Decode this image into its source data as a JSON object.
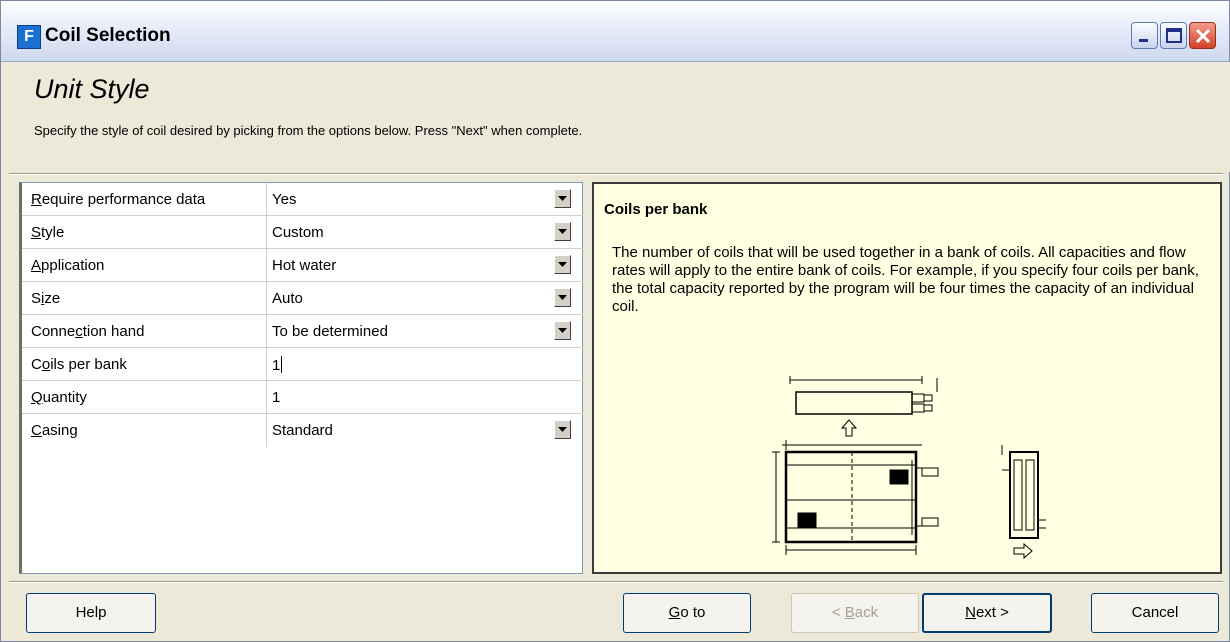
{
  "window": {
    "title": "Coil Selection",
    "app_icon_glyph": "F"
  },
  "header": {
    "title": "Unit Style",
    "description": "Specify the style of coil desired by picking from the options below.  Press \"Next\" when complete."
  },
  "properties": [
    {
      "pre": "",
      "accel": "R",
      "post": "equire performance data",
      "value": "Yes",
      "dropdown": true
    },
    {
      "pre": "",
      "accel": "S",
      "post": "tyle",
      "value": "Custom",
      "dropdown": true
    },
    {
      "pre": "",
      "accel": "A",
      "post": "pplication",
      "value": "Hot water",
      "dropdown": true
    },
    {
      "pre": "S",
      "accel": "i",
      "post": "ze",
      "value": "Auto",
      "dropdown": true
    },
    {
      "pre": "Conne",
      "accel": "c",
      "post": "tion hand",
      "value": "To be determined",
      "dropdown": true
    },
    {
      "pre": "C",
      "accel": "o",
      "post": "ils per bank",
      "value": "1",
      "dropdown": false,
      "editing": true
    },
    {
      "pre": "",
      "accel": "Q",
      "post": "uantity",
      "value": "1",
      "dropdown": false
    },
    {
      "pre": "",
      "accel": "C",
      "post": "asing",
      "value": "Standard",
      "dropdown": true
    }
  ],
  "help": {
    "title": "Coils per bank",
    "text": "The number of coils that will be used together in a bank of coils.  All capacities and flow rates will apply to the entire bank of coils.  For example, if you specify four coils per bank, the total capacity reported by the program will be four times the capacity of an individual coil."
  },
  "buttons": {
    "help": "Help",
    "goto_accel": "G",
    "goto_rest": "o to",
    "back_pre": "< ",
    "back_accel": "B",
    "back_rest": "ack",
    "next_accel": "N",
    "next_rest": "ext >",
    "cancel": "Cancel"
  },
  "colors": {
    "help_background": "#ffffe1",
    "dialog_background": "#ece9d8",
    "close_button": "#d4412a"
  },
  "icons": [
    "app-icon",
    "minimize-icon",
    "maximize-icon",
    "close-icon",
    "dropdown-arrow-icon",
    "coil-diagram"
  ]
}
